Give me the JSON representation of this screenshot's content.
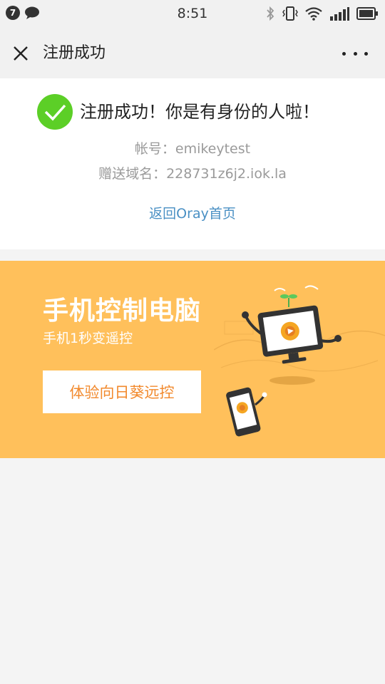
{
  "status_bar": {
    "notification_count": "7",
    "time": "8:51",
    "icons": [
      "chat-bubble-icon",
      "bluetooth-icon",
      "vibrate-icon",
      "wifi-icon",
      "signal-icon",
      "battery-icon"
    ]
  },
  "nav": {
    "title": "注册成功",
    "close_icon": "close-icon",
    "more_icon": "more-icon"
  },
  "success": {
    "message": "注册成功！你是有身份的人啦！",
    "account_line": "帐号：emikeytest",
    "domain_line": "赠送域名：228731z6j2.iok.la",
    "home_link": "返回Oray首页"
  },
  "promo": {
    "title": "手机控制电脑",
    "subtitle": "手机1秒变遥控",
    "button_label": "体验向日葵远控"
  },
  "colors": {
    "success_green": "#5ccf27",
    "link_blue": "#4a90c4",
    "promo_bg": "#ffc05b",
    "promo_button_text": "#f28a2e"
  }
}
